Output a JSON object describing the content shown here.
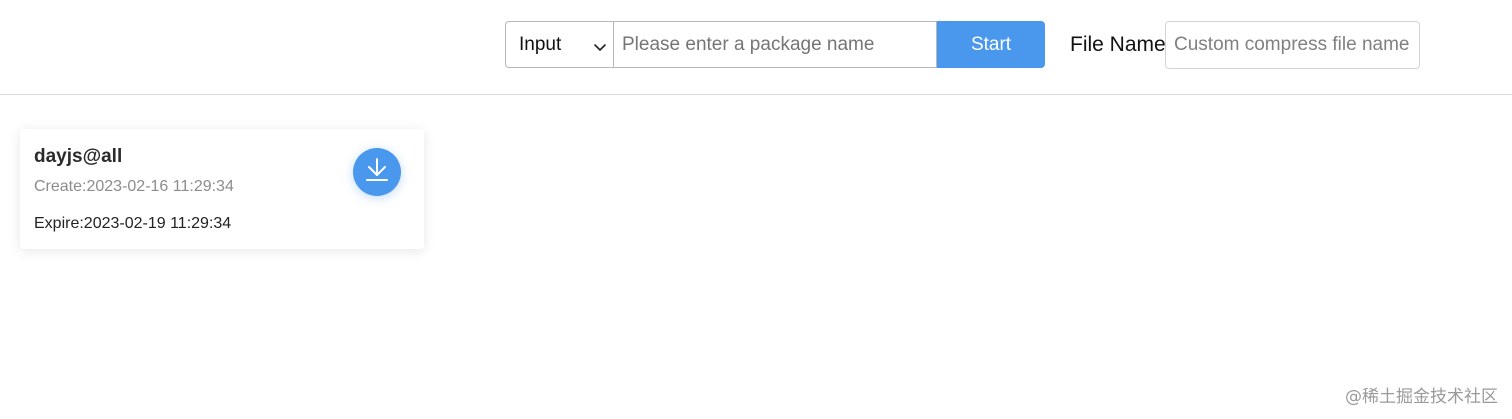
{
  "toolbar": {
    "type_select": {
      "selected": "Input"
    },
    "package_input": {
      "value": "",
      "placeholder": "Please enter a package name"
    },
    "start_label": "Start",
    "file_name_label": "File Name",
    "file_name_input": {
      "value": "",
      "placeholder": "Custom compress file name"
    }
  },
  "packages": [
    {
      "name": "dayjs@all",
      "create": "Create:2023-02-16 11:29:34",
      "expire": "Expire:2023-02-19 11:29:34"
    }
  ],
  "watermark": "@稀土掘金技术社区",
  "colors": {
    "accent": "#4a98ee",
    "border": "#b8b8b8",
    "muted_text": "#8c8c8c"
  },
  "icons": {
    "select_arrow": "chevron-down-icon",
    "download": "download-icon"
  }
}
